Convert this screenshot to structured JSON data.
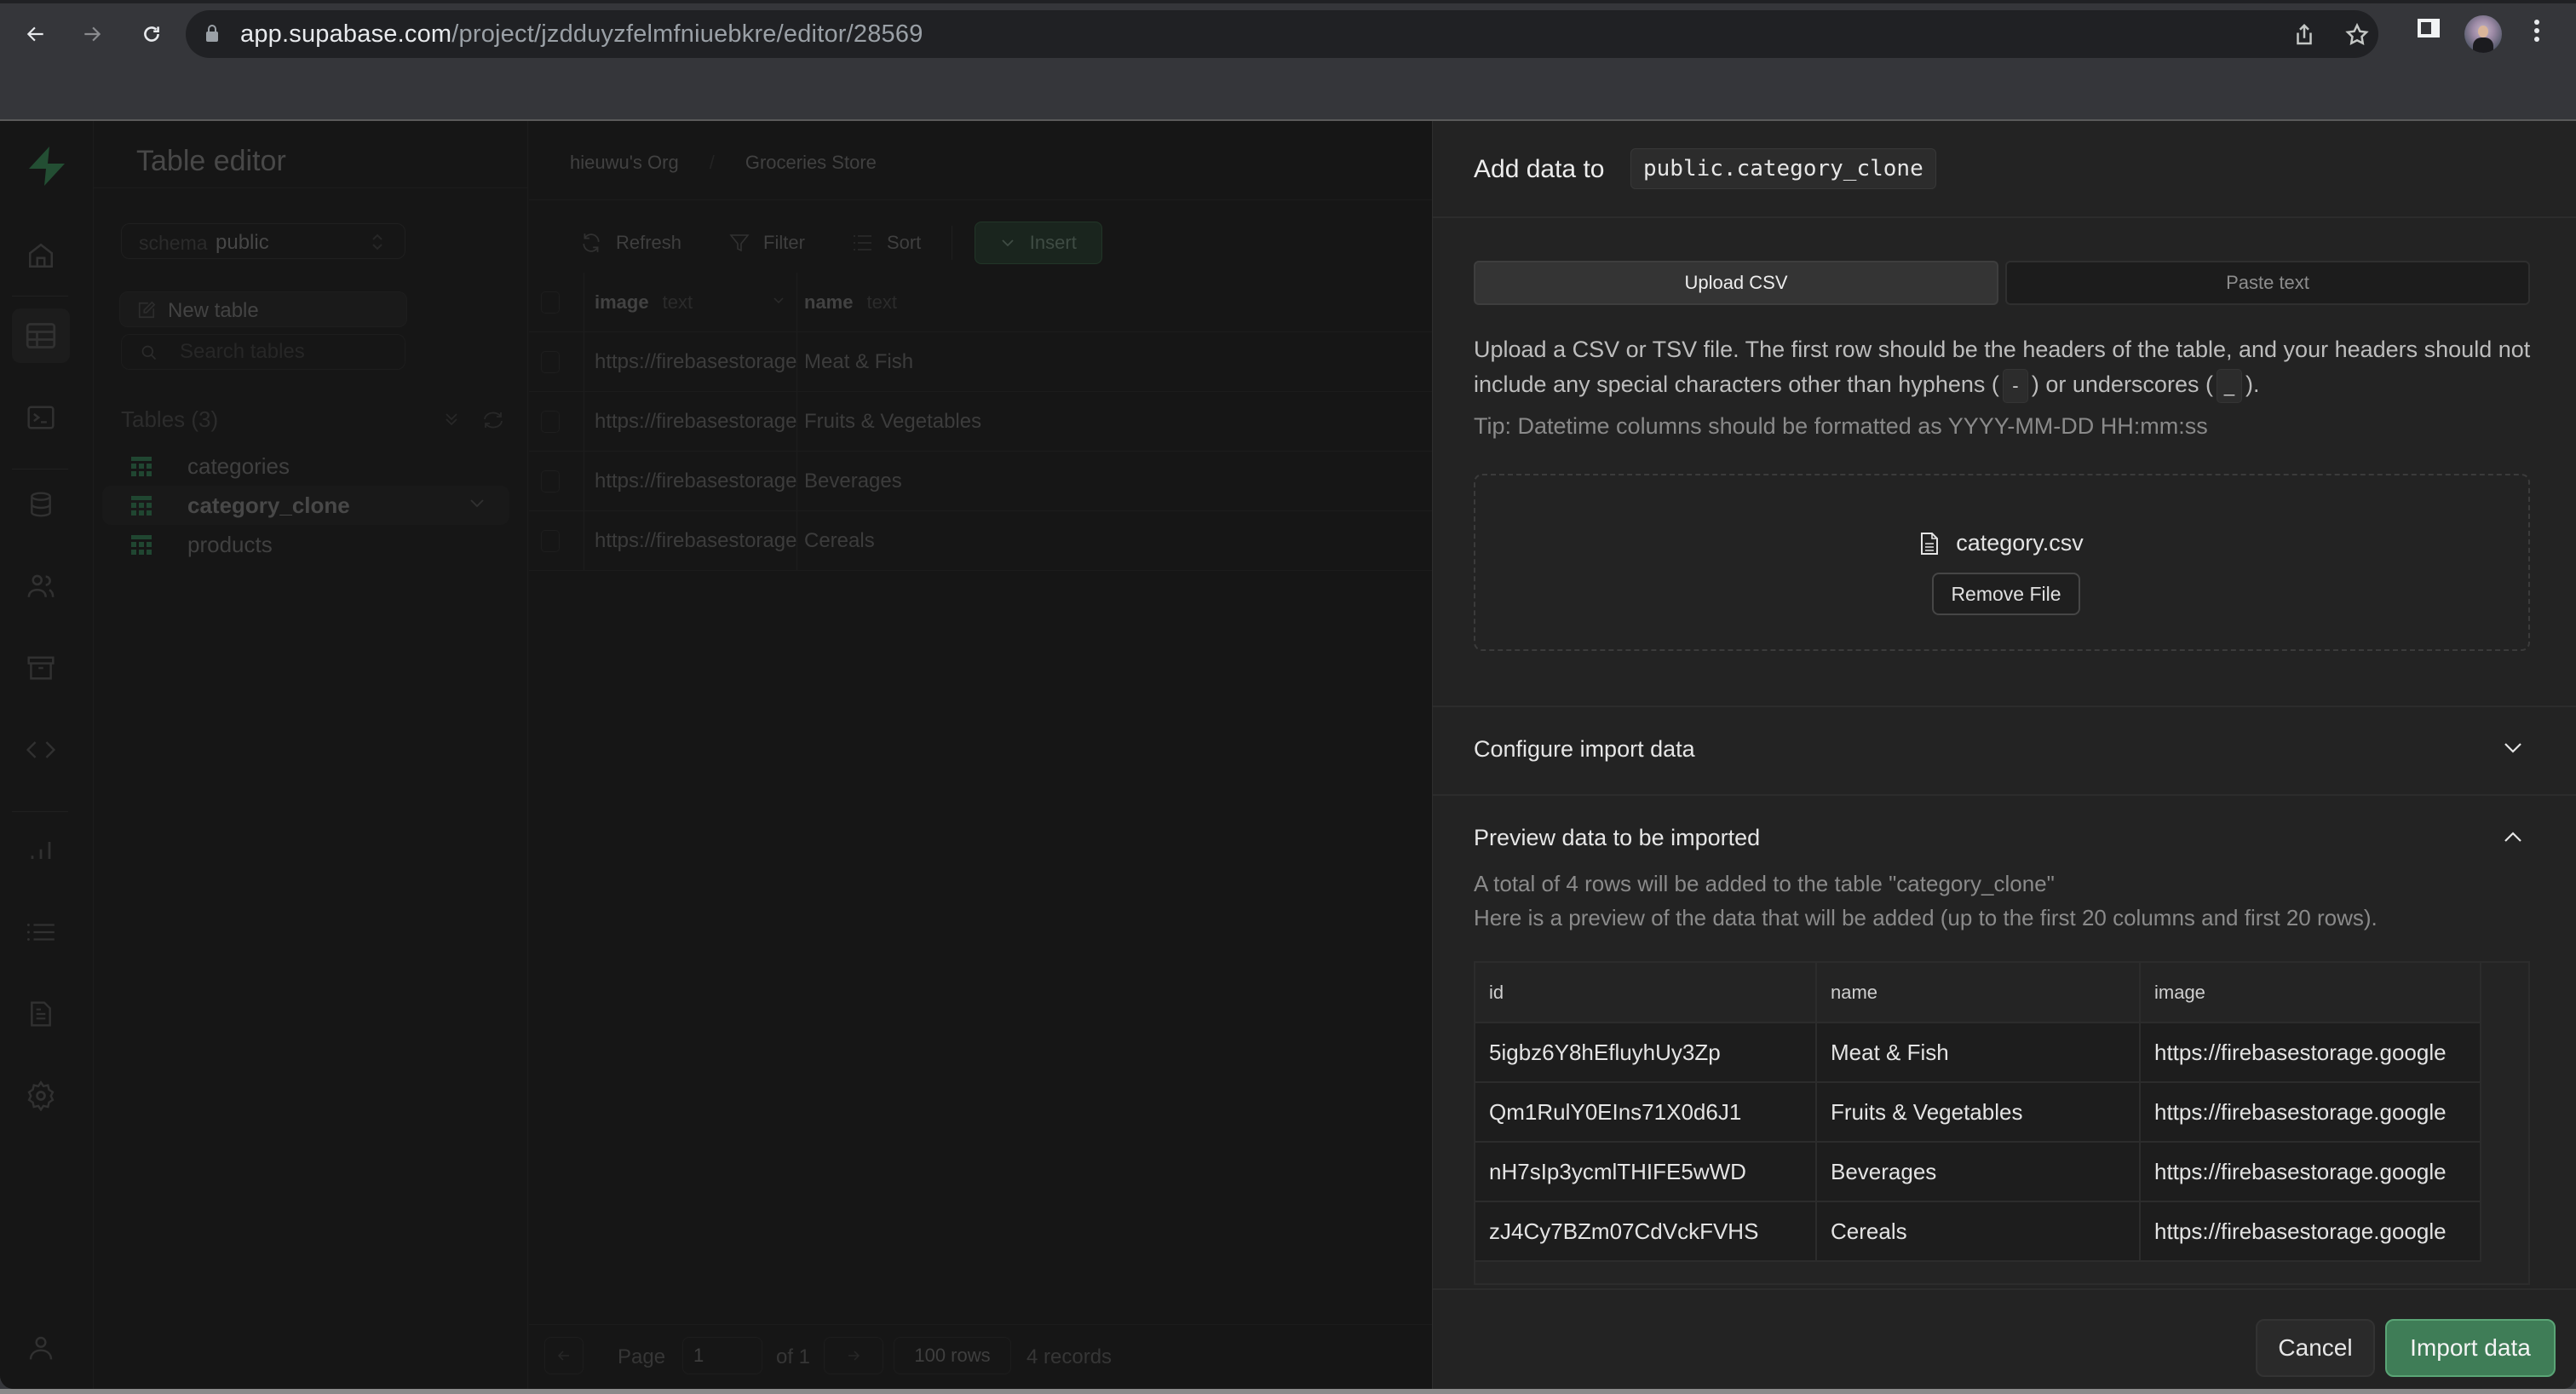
{
  "browser": {
    "url_host": "app.supabase.com",
    "url_path": "/project/jzdduyzfelmfniuebkre/editor/28569"
  },
  "rail": {
    "items": [
      {
        "name": "home"
      },
      {
        "name": "table-editor"
      },
      {
        "name": "sql-editor"
      },
      {
        "name": "database"
      },
      {
        "name": "authentication"
      },
      {
        "name": "storage"
      },
      {
        "name": "edge-functions"
      },
      {
        "name": "reports"
      },
      {
        "name": "logs"
      },
      {
        "name": "api-docs"
      },
      {
        "name": "settings"
      }
    ]
  },
  "sidebar": {
    "title": "Table editor",
    "schema_label": "schema",
    "schema_value": "public",
    "new_table": "New table",
    "search_placeholder": "Search tables",
    "tables_heading": "Tables (3)",
    "tables": [
      {
        "name": "categories",
        "active": false
      },
      {
        "name": "category_clone",
        "active": true
      },
      {
        "name": "products",
        "active": false
      }
    ]
  },
  "main": {
    "breadcrumb": [
      "hieuwu's Org",
      "Groceries Store"
    ],
    "toolbar": {
      "refresh": "Refresh",
      "filter": "Filter",
      "sort": "Sort",
      "insert": "Insert"
    },
    "columns": [
      {
        "name": "image",
        "type": "text"
      },
      {
        "name": "name",
        "type": "text"
      }
    ],
    "rows": [
      {
        "image": "https://firebasestorage.googleapis.com/v",
        "name": "Meat & Fish"
      },
      {
        "image": "https://firebasestorage.googleapis.com/v",
        "name": "Fruits & Vegetables"
      },
      {
        "image": "https://firebasestorage.googleapis.com/v",
        "name": "Beverages"
      },
      {
        "image": "https://firebasestorage.googleapis.com/v",
        "name": "Cereals"
      }
    ],
    "pager": {
      "page_label": "Page",
      "page_value": "1",
      "of_label": "of 1",
      "rows_per_page": "100 rows",
      "records": "4 records"
    }
  },
  "panel": {
    "title": "Add data to",
    "target_table": "public.category_clone",
    "tabs": [
      {
        "label": "Upload CSV",
        "active": true
      },
      {
        "label": "Paste text",
        "active": false
      }
    ],
    "description_part1": "Upload a CSV or TSV file. The first row should be the headers of the table, and your headers should not include any special characters other than hyphens (",
    "hyphen": "-",
    "description_part2": ") or underscores (",
    "underscore": "_",
    "description_part3": ").",
    "tip": "Tip: Datetime columns should be formatted as YYYY-MM-DD HH:mm:ss",
    "file_name": "category.csv",
    "remove_file": "Remove File",
    "configure_section": "Configure import data",
    "preview_section": "Preview data to be imported",
    "preview_summary": "A total of 4 rows will be added to the table \"category_clone\"",
    "preview_note": "Here is a preview of the data that will be added (up to the first 20 columns and first 20 rows).",
    "preview_columns": [
      "id",
      "name",
      "image"
    ],
    "preview_rows": [
      [
        "5igbz6Y8hEfluyhUy3Zp",
        "Meat & Fish",
        "https://firebasestorage.google"
      ],
      [
        "Qm1RulY0EIns71X0d6J1",
        "Fruits & Vegetables",
        "https://firebasestorage.google"
      ],
      [
        "nH7sIp3ycmlTHIFE5wWD",
        "Beverages",
        "https://firebasestorage.google"
      ],
      [
        "zJ4Cy7BZm07CdVckFVHS",
        "Cereals",
        "https://firebasestorage.google"
      ]
    ],
    "cancel": "Cancel",
    "import": "Import data"
  },
  "colors": {
    "brand_green": "#3ecf8e",
    "import_button": "#3f7d57",
    "panel_bg": "#232323"
  }
}
